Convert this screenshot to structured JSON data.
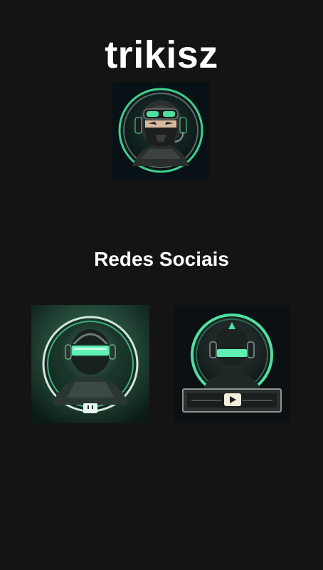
{
  "profile": {
    "name": "trikisz",
    "avatar_icon": "ninja-headset-avatar-icon"
  },
  "socials": {
    "heading": "Redes Sociais",
    "links": [
      {
        "platform_icon": "twitch-icon",
        "image_icon": "gamer-visor-twitch-icon"
      },
      {
        "platform_icon": "youtube-icon",
        "image_icon": "gamer-visor-youtube-icon"
      }
    ]
  },
  "colors": {
    "background": "#141414",
    "accent": "#4fe0a0",
    "text": "#ffffff"
  }
}
